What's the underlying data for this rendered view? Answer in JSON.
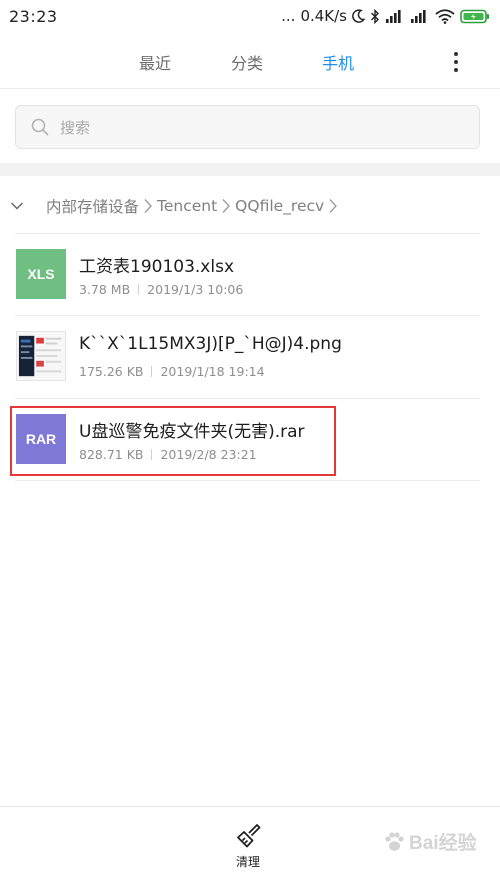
{
  "status_bar": {
    "time": "23:23",
    "dots": "...",
    "speed": "0.4K/s"
  },
  "tabs": [
    {
      "label": "最近",
      "active": false
    },
    {
      "label": "分类",
      "active": false
    },
    {
      "label": "手机",
      "active": true
    }
  ],
  "search": {
    "placeholder": "搜索"
  },
  "breadcrumb": [
    "内部存储设备",
    "Tencent",
    "QQfile_recv"
  ],
  "files": [
    {
      "name": "工资表190103.xlsx",
      "size": "3.78 MB",
      "date": "2019/1/3 10:06",
      "icon_text": "XLS"
    },
    {
      "name": "K``X`1L15MX3J)[P_`H@J)4.png",
      "size": "175.26 KB",
      "date": "2019/1/18 19:14",
      "icon_text": ""
    },
    {
      "name": "U盘巡警免疫文件夹(无害).rar",
      "size": "828.71 KB",
      "date": "2019/2/8 23:21",
      "icon_text": "RAR"
    }
  ],
  "bottom_bar": {
    "clean_label": "清理"
  },
  "watermark": {
    "text": "Bai经验"
  },
  "colors": {
    "accent": "#1e8ef0",
    "xls": "#6fbf83",
    "rar": "#7f78d6",
    "highlight": "#e53935"
  }
}
